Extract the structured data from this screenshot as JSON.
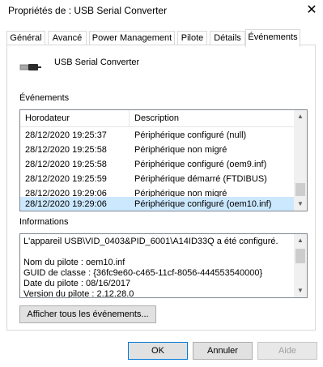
{
  "window": {
    "title": "Propriétés de : USB Serial Converter"
  },
  "tabs": [
    {
      "label": "Général"
    },
    {
      "label": "Avancé"
    },
    {
      "label": "Power Management"
    },
    {
      "label": "Pilote"
    },
    {
      "label": "Détails"
    },
    {
      "label": "Événements",
      "active": true
    }
  ],
  "device": {
    "name": "USB Serial Converter",
    "icon": "usb-plug-icon"
  },
  "events": {
    "section_label": "Événements",
    "columns": [
      "Horodateur",
      "Description"
    ],
    "rows": [
      {
        "time": "28/12/2020 19:25:37",
        "desc": "Périphérique configuré (null)"
      },
      {
        "time": "28/12/2020 19:25:58",
        "desc": "Périphérique non migré"
      },
      {
        "time": "28/12/2020 19:25:58",
        "desc": "Périphérique configuré (oem9.inf)"
      },
      {
        "time": "28/12/2020 19:25:59",
        "desc": "Périphérique démarré (FTDIBUS)"
      },
      {
        "time": "28/12/2020 19:29:06",
        "desc": "Périphérique non migré"
      },
      {
        "time": "28/12/2020 19:29:06",
        "desc": "Périphérique configuré (oem10.inf)",
        "selected": true
      }
    ]
  },
  "information": {
    "section_label": "Informations",
    "lines": [
      "L'appareil USB\\VID_0403&PID_6001\\A14ID33Q a été configuré.",
      "",
      "Nom du pilote : oem10.inf",
      "GUID de classe : {36fc9e60-c465-11cf-8056-444553540000}",
      "Date du pilote : 08/16/2017",
      "Version du pilote : 2.12.28.0"
    ]
  },
  "buttons": {
    "show_all": "Afficher tous les événements...",
    "ok": "OK",
    "cancel": "Annuler",
    "help": "Aide"
  },
  "colors": {
    "selection": "#cce8ff",
    "default_button_border": "#0078d7"
  }
}
